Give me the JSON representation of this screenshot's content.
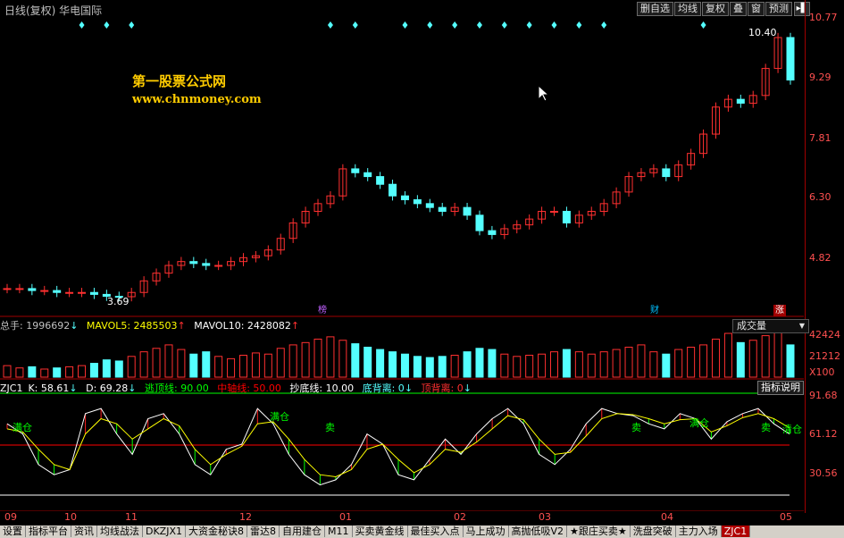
{
  "window": {
    "title": "日线(复权)  华电国际"
  },
  "toolbar": {
    "buttons": [
      "删自选",
      "均线",
      "复权",
      "叠",
      "窗",
      "预测"
    ]
  },
  "price_axis": {
    "ticks": [
      "10.77",
      "9.29",
      "7.81",
      "6.30",
      "4.82"
    ]
  },
  "price_panel": {
    "watermark_cn": "第一股票公式网",
    "watermark_url": "www.chnmoney.com",
    "high_label": "10.40",
    "low_label": "3.69",
    "event_tags": [
      "榜",
      "财",
      "涨"
    ]
  },
  "volume_panel": {
    "total_label": "总手: 1996692",
    "mavol5_label": "MAVOL5: 2485503",
    "mavol10_label": "MAVOL10: 2428082",
    "selector": "成交量",
    "ticks": [
      "42424",
      "21212",
      "X100"
    ]
  },
  "indicator_panel": {
    "name": "ZJC1",
    "k_label": "K: 58.61",
    "d_label": "D: 69.28",
    "escape_label": "逃顶线: 90.00",
    "mid_label": "中轴线: 50.00",
    "bottom_label": "抄底线: 10.00",
    "div_bottom_label": "底背离: 0",
    "div_top_label": "顶背离: 0",
    "explain_button": "指标说明",
    "ticks": [
      "91.68",
      "61.12",
      "30.56"
    ],
    "signal_labels": [
      "满仓",
      "满仓",
      "卖",
      "卖",
      "满仓",
      "卖",
      "清仓"
    ]
  },
  "date_axis": {
    "labels": [
      "09",
      "10",
      "11",
      "12",
      "01",
      "02",
      "03",
      "04",
      "05"
    ]
  },
  "bottom_tabs": [
    "设置",
    "指标平台",
    "资讯",
    "均线战法",
    "DKZJX1",
    "大资金秘诀8",
    "雷达8",
    "自用建仓",
    "M11",
    "买卖黄金线",
    "最佳买入点",
    "马上成功",
    "高抛低吸V2",
    "★跟庄买卖★",
    "洗盘突破",
    "主力入场",
    "ZJC1"
  ],
  "colors": {
    "up": "#ff3030",
    "down": "#54ffff",
    "axis": "#a00000",
    "text_red": "#ff5050",
    "green": "#00ff00",
    "yellow": "#ffff00",
    "watermark": "#ffcc00"
  },
  "chart_data": {
    "type": "candlestick",
    "series": [
      {
        "name": "price",
        "values": [
          3.9,
          3.9,
          3.85,
          3.85,
          3.8,
          3.8,
          3.8,
          3.75,
          3.7,
          3.69,
          3.8,
          4.1,
          4.3,
          4.5,
          4.6,
          4.55,
          4.5,
          4.5,
          4.6,
          4.7,
          4.75,
          4.9,
          5.2,
          5.6,
          5.9,
          6.1,
          6.3,
          7.0,
          6.9,
          6.8,
          6.6,
          6.3,
          6.2,
          6.1,
          6.0,
          5.9,
          6.0,
          5.8,
          5.4,
          5.3,
          5.45,
          5.55,
          5.7,
          5.9,
          5.9,
          5.6,
          5.8,
          5.9,
          6.1,
          6.4,
          6.8,
          6.9,
          7.0,
          6.8,
          7.1,
          7.4,
          7.9,
          8.6,
          8.8,
          8.7,
          8.9,
          9.6,
          10.4,
          9.3
        ]
      },
      {
        "name": "volume",
        "values": [
          10,
          8,
          9,
          7,
          8,
          9,
          10,
          12,
          15,
          14,
          18,
          22,
          25,
          28,
          24,
          20,
          22,
          18,
          16,
          19,
          21,
          20,
          25,
          28,
          30,
          33,
          35,
          32,
          29,
          26,
          24,
          22,
          20,
          18,
          17,
          18,
          19,
          22,
          25,
          24,
          20,
          18,
          19,
          20,
          22,
          24,
          22,
          20,
          22,
          24,
          26,
          28,
          22,
          20,
          24,
          26,
          28,
          33,
          38,
          30,
          32,
          36,
          45,
          28
        ]
      },
      {
        "name": "K",
        "values": [
          70,
          60,
          30,
          20,
          25,
          80,
          85,
          60,
          40,
          75,
          80,
          60,
          30,
          20,
          45,
          50,
          85,
          70,
          40,
          20,
          10,
          15,
          30,
          60,
          50,
          20,
          15,
          35,
          55,
          40,
          60,
          75,
          85,
          70,
          40,
          30,
          45,
          70,
          85,
          80,
          78,
          70,
          65,
          80,
          75,
          55,
          72,
          80,
          85,
          70,
          60
        ]
      },
      {
        "name": "D",
        "values": [
          65,
          62,
          45,
          30,
          25,
          60,
          75,
          70,
          55,
          65,
          75,
          68,
          45,
          30,
          40,
          48,
          70,
          72,
          55,
          35,
          20,
          18,
          25,
          45,
          50,
          35,
          22,
          30,
          45,
          42,
          52,
          65,
          78,
          74,
          55,
          40,
          42,
          58,
          75,
          80,
          79,
          75,
          70,
          74,
          75,
          62,
          68,
          76,
          80,
          75,
          66
        ]
      }
    ],
    "x": [
      "09",
      "10",
      "11",
      "12",
      "01",
      "02",
      "03",
      "04",
      "05"
    ],
    "ylim": [
      3.69,
      10.77
    ],
    "grid": false
  }
}
